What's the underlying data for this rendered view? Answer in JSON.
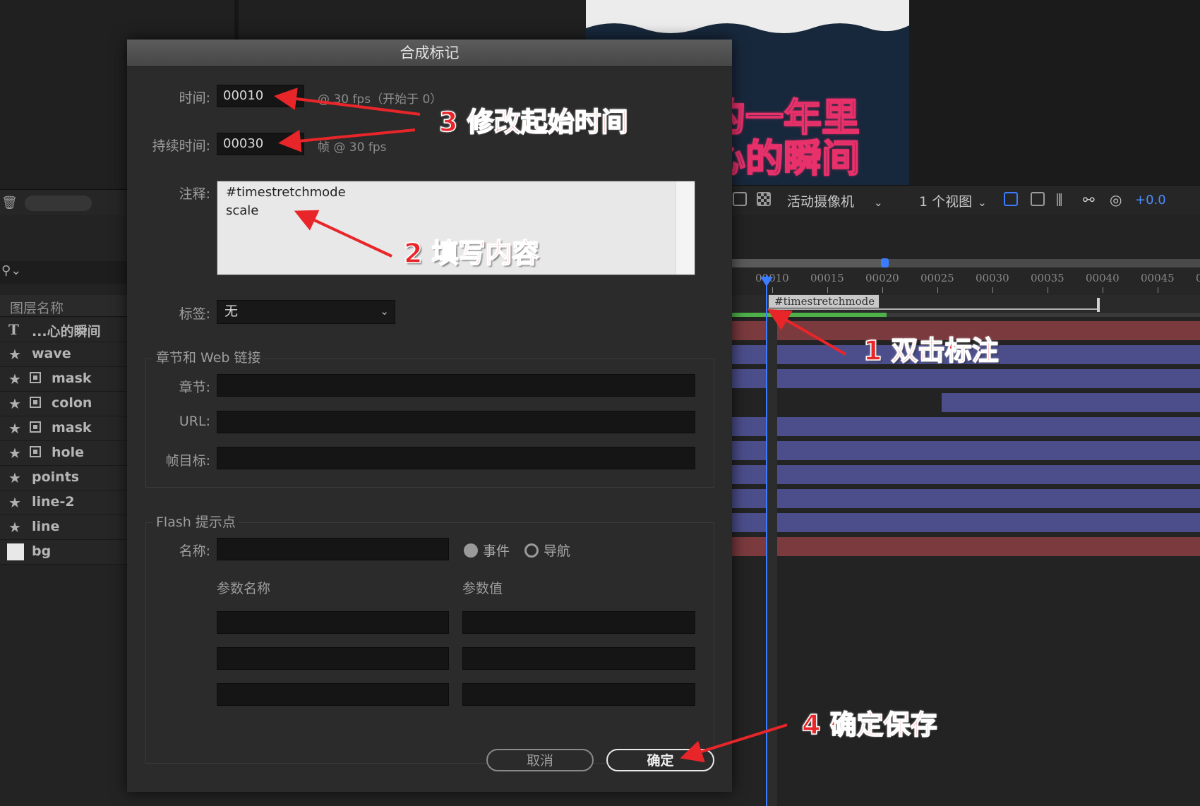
{
  "preview": {
    "line1": "的一年里",
    "line2": "心的瞬间"
  },
  "viewer_bar": {
    "camera": "活动摄像机",
    "views": "1 个视图",
    "exposure": "+0.0"
  },
  "layers": {
    "header": "图层名称",
    "items": [
      {
        "name": "...心的瞬间",
        "kind": "text"
      },
      {
        "name": "wave",
        "kind": "shape"
      },
      {
        "name": "mask",
        "kind": "shape-masked"
      },
      {
        "name": "colon",
        "kind": "shape-masked"
      },
      {
        "name": "mask",
        "kind": "shape-masked"
      },
      {
        "name": "hole",
        "kind": "shape-masked"
      },
      {
        "name": "points",
        "kind": "shape"
      },
      {
        "name": "line-2",
        "kind": "shape"
      },
      {
        "name": "line",
        "kind": "shape"
      },
      {
        "name": "bg",
        "kind": "solid"
      }
    ]
  },
  "timeline": {
    "ticks": [
      "00010",
      "00015",
      "00020",
      "00025",
      "00030",
      "00035",
      "00040",
      "00045",
      "0"
    ],
    "marker_label": "#timestretchmode",
    "tracks": [
      "red",
      "blue",
      "blue",
      "blue-partial",
      "blue",
      "blue",
      "blue",
      "blue",
      "blue",
      "red"
    ]
  },
  "dialog": {
    "title": "合成标记",
    "time_label": "时间:",
    "time_value": "00010",
    "time_note": "@ 30 fps（开始于 0）",
    "duration_label": "持续时间:",
    "duration_value": "00030",
    "duration_note": "帧 @ 30 fps",
    "comment_label": "注释:",
    "comment_line1": "#timestretchmode",
    "comment_line2": "scale",
    "tag_label": "标签:",
    "tag_value": "无",
    "chapter_group": "章节和 Web 链接",
    "chapter_label": "章节:",
    "url_label": "URL:",
    "frame_target_label": "帧目标:",
    "flash_group": "Flash 提示点",
    "name_label": "名称:",
    "radio_event": "事件",
    "radio_nav": "导航",
    "param_name_header": "参数名称",
    "param_value_header": "参数值",
    "cancel": "取消",
    "ok": "确定"
  },
  "annotations": {
    "step1": "1 双击标注",
    "step2": "2 填写内容",
    "step3": "3 修改起始时间",
    "step4": "4 确定保存"
  },
  "colors": {
    "annotation": "#e8262a",
    "playhead": "#3b7cff",
    "track_blue": "#4c4e8c",
    "track_red": "#7a3a3e"
  }
}
